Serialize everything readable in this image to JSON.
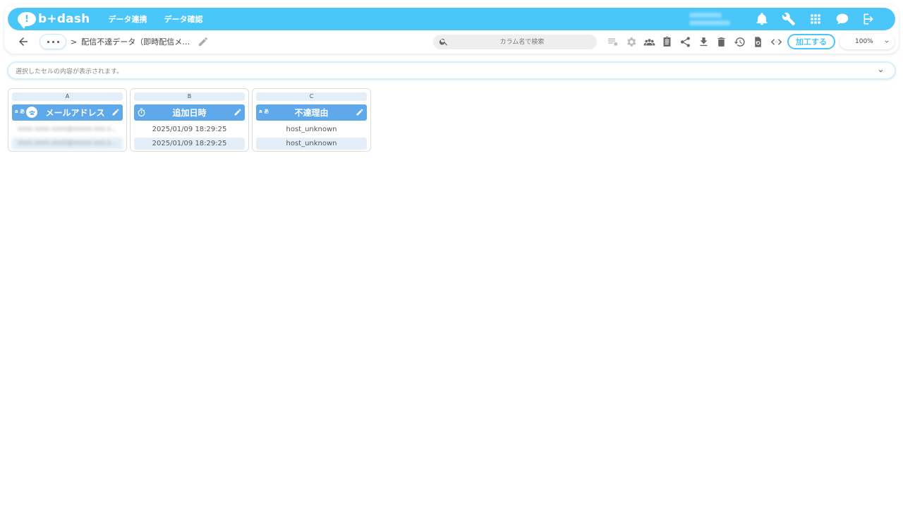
{
  "app": {
    "logo_mark": "!",
    "logo_text": "b+dash"
  },
  "nav": {
    "links": [
      "データ連携",
      "データ確認"
    ],
    "icons": [
      "bell-icon",
      "wrench-icon",
      "grid-icon",
      "chat-icon",
      "login-icon"
    ]
  },
  "toolbar": {
    "dots_label": "•••",
    "breadcrumb_sep": ">",
    "breadcrumb": "配信不達データ（即時配信メ…",
    "search_placeholder": "カラム名で検索",
    "process_button": "加工する",
    "zoom_value": "100%",
    "icons": [
      "list-icon",
      "gear-icon",
      "users-icon",
      "clipboard-icon",
      "share-icon",
      "download-icon",
      "trash-icon",
      "history-icon",
      "refresh-file-icon",
      "code-icon"
    ]
  },
  "cell_viewer": {
    "placeholder": "選択したセルの内容が表示されます。"
  },
  "columns": [
    {
      "letter": "A",
      "type_label": "a あ",
      "name": "メールアドレス",
      "values": [
        "xxxx.xxxx.xxxx@xxxxx.xxx.x…",
        "xxxx.xxxx.xxxx@xxxxx.xxx.x…"
      ]
    },
    {
      "letter": "B",
      "type_label": "",
      "name": "追加日時",
      "values": [
        "2025/01/09 18:29:25",
        "2025/01/09 18:29:25"
      ]
    },
    {
      "letter": "C",
      "type_label": "a あ",
      "name": "不達理由",
      "values": [
        "host_unknown",
        "host_unknown"
      ]
    }
  ]
}
